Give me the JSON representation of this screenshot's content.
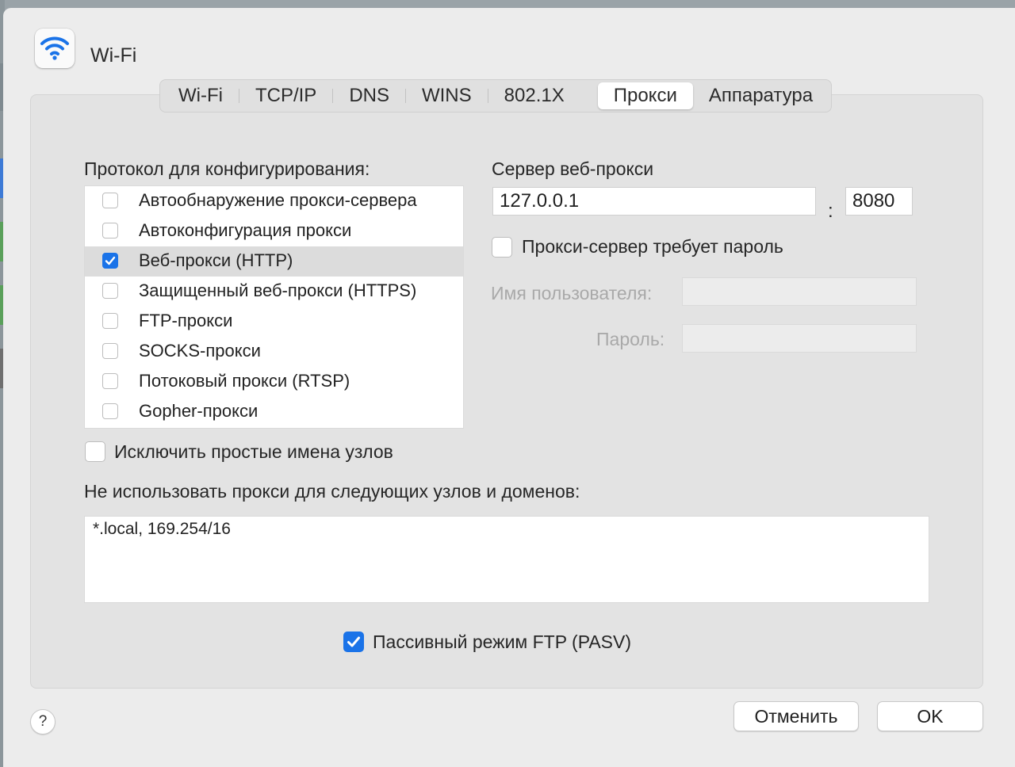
{
  "window": {
    "title": "Wi-Fi",
    "icon": "wifi-icon"
  },
  "tabs": [
    {
      "label": "Wi-Fi",
      "active": false
    },
    {
      "label": "TCP/IP",
      "active": false
    },
    {
      "label": "DNS",
      "active": false
    },
    {
      "label": "WINS",
      "active": false
    },
    {
      "label": "802.1X",
      "active": false
    },
    {
      "label": "Прокси",
      "active": true
    },
    {
      "label": "Аппаратура",
      "active": false
    }
  ],
  "protocols": {
    "heading": "Протокол для конфигурирования:",
    "items": [
      {
        "label": "Автообнаружение прокси-сервера",
        "checked": false,
        "selected": false
      },
      {
        "label": "Автоконфигурация прокси",
        "checked": false,
        "selected": false
      },
      {
        "label": "Веб-прокси (HTTP)",
        "checked": true,
        "selected": true
      },
      {
        "label": "Защищенный веб-прокси (HTTPS)",
        "checked": false,
        "selected": false
      },
      {
        "label": "FTP-прокси",
        "checked": false,
        "selected": false
      },
      {
        "label": "SOCKS-прокси",
        "checked": false,
        "selected": false
      },
      {
        "label": "Потоковый прокси (RTSP)",
        "checked": false,
        "selected": false
      },
      {
        "label": "Gopher-прокси",
        "checked": false,
        "selected": false
      }
    ]
  },
  "server": {
    "heading": "Сервер веб-прокси",
    "host": "127.0.0.1",
    "separator": ":",
    "port": "8080",
    "requires_password_label": "Прокси-сервер требует пароль",
    "requires_password": false,
    "username_label": "Имя пользователя:",
    "username": "",
    "password_label": "Пароль:",
    "password": ""
  },
  "exclude_simple": {
    "label": "Исключить простые имена узлов",
    "checked": false
  },
  "bypass": {
    "label": "Не использовать прокси для следующих узлов и доменов:",
    "value": "*.local, 169.254/16"
  },
  "passive_ftp": {
    "label": "Пассивный режим FTP (PASV)",
    "checked": true
  },
  "footer": {
    "help_label": "?",
    "cancel_label": "Отменить",
    "ok_label": "OK"
  },
  "colors": {
    "accent": "#1a73e8",
    "selected_row": "#dcdcdc",
    "disabled_text": "#a9a9a9"
  }
}
